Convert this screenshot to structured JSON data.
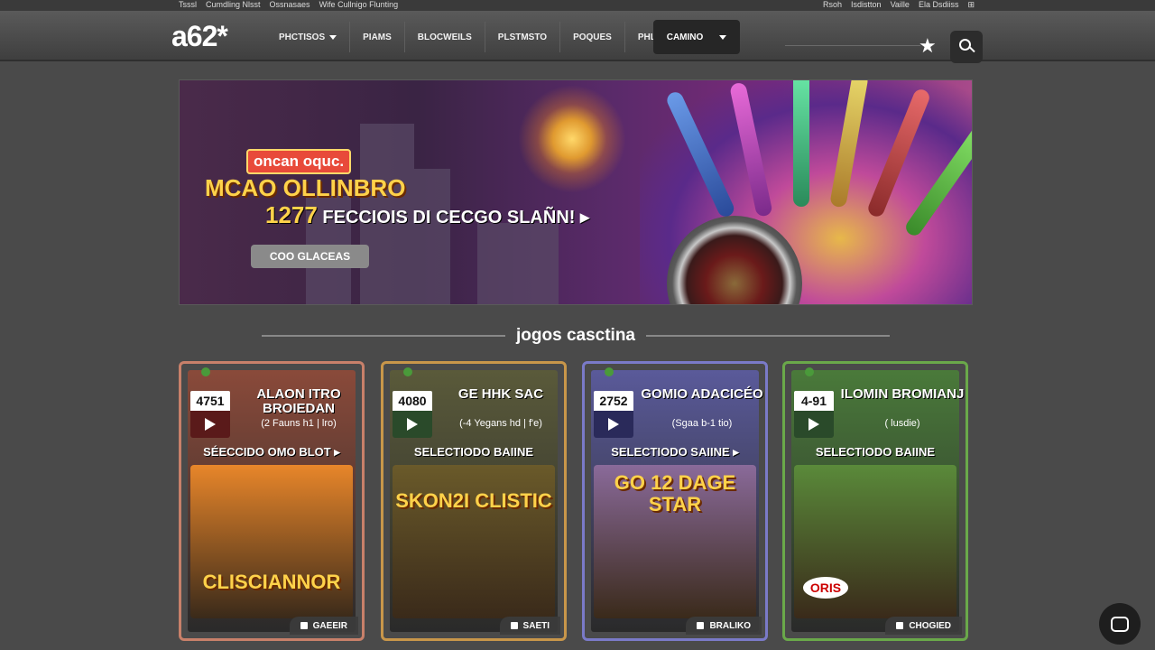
{
  "topbar": {
    "left": [
      "Tsssl",
      "Cumdling Nlsst",
      "Ossnasaes",
      "Wife Cullnigo Flunting"
    ],
    "right": [
      "Rsoh",
      "Isdistton",
      "Vaille",
      "Ela Dsdiiss",
      "⊞"
    ]
  },
  "header": {
    "logo": "a62*",
    "nav": [
      {
        "label": "PHCTISOS",
        "has_caret": true
      },
      {
        "label": "PIAMS",
        "has_caret": false
      },
      {
        "label": "BLOCWEILS",
        "has_caret": false
      },
      {
        "label": "PLSTMSTO",
        "has_caret": false
      },
      {
        "label": "POQUES",
        "has_caret": false
      },
      {
        "label": "PHL",
        "has_caret": false
      }
    ],
    "casino": "CAMINO",
    "star_icon": "star-icon",
    "search_icon": "search-icon"
  },
  "hero": {
    "badge": "oncan oquc.",
    "title": "MCAO OLLINBRO",
    "number": "1277",
    "subtitle": "FECCIOIS DI CECGO SLAÑN! ▸",
    "button": "COO GLACEAS"
  },
  "section": {
    "title": "jogos casctina"
  },
  "cards": [
    {
      "count": "4751",
      "name": "ALAON ITRO BROIEDAN",
      "meta": "(2 Fauns h1 | lro)",
      "select": "SÉECCIDO OMO BLOT ▸",
      "art_text": "CLISCIANNOR",
      "tag": "GAEEIR",
      "border": "#c8806a",
      "bg": "#8a4a3a",
      "art_bg": "#e8862a",
      "play_bg": "#5a1a1a"
    },
    {
      "count": "4080",
      "name": "GE HHK SAC",
      "meta": "(-4 Yegans hd | f'e)",
      "select": "SELECTIODO BAIINE",
      "art_text": "SKON2I CLISTIC",
      "tag": "SAETI",
      "border": "#c8964a",
      "bg": "#5a5a3a",
      "art_bg": "#6a5a2a",
      "play_bg": "#2a4a2a"
    },
    {
      "count": "2752",
      "name": "GOMIO ADACICÉO",
      "meta": "(Sgaa b-1 tio)",
      "select": "SELECTIODO SAIINE ▸",
      "art_text": "GO 12 DAGE STAR",
      "tag": "BRALIKO",
      "border": "#7a7ac8",
      "bg": "#5a5a9a",
      "art_bg": "#8a6a9a",
      "play_bg": "#2a2a5a"
    },
    {
      "count": "4-91",
      "name": "ILOMIN BROMIANJ",
      "meta": "( lusdie)",
      "select": "SELECTIODO BAIINE",
      "art_text": "ORIS",
      "tag": "CHOGIED",
      "border": "#6aa84a",
      "bg": "#4a7a3a",
      "art_bg": "#5a8a3a",
      "play_bg": "#2a4a2a"
    }
  ],
  "chat": "chat-icon"
}
